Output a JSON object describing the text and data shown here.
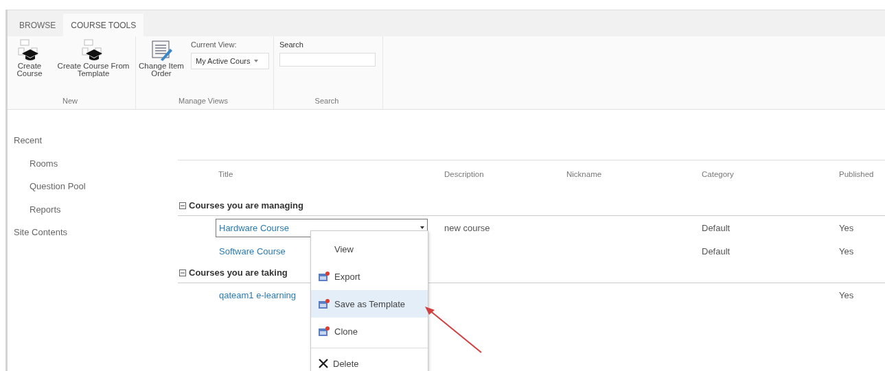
{
  "ribbon": {
    "tabs": [
      {
        "label": "BROWSE",
        "selected": false
      },
      {
        "label": "COURSE TOOLS",
        "selected": true
      }
    ],
    "groups": [
      {
        "name": "New",
        "buttons": [
          {
            "label": "Create Course",
            "kind": "course"
          },
          {
            "label": "Create Course From Template",
            "kind": "course"
          }
        ]
      },
      {
        "name": "Manage Views",
        "buttons": [
          {
            "label": "Change Item Order",
            "kind": "order"
          }
        ],
        "view_label": "Current View:",
        "view_value": "My Active Cours"
      },
      {
        "name": "Search",
        "search_label": "Search"
      }
    ]
  },
  "nav": [
    {
      "label": "Recent",
      "children": [
        {
          "label": "Rooms"
        },
        {
          "label": "Question Pool"
        },
        {
          "label": "Reports"
        }
      ]
    },
    {
      "label": "Site Contents"
    }
  ],
  "table": {
    "columns": [
      "Title",
      "Description",
      "Nickname",
      "Category",
      "Published"
    ],
    "groups": [
      {
        "title": "Courses you are managing",
        "expanded": true,
        "rows": [
          {
            "title": "Hardware Course",
            "description": "new course",
            "category": "Default",
            "published": "Yes",
            "focused": true
          },
          {
            "title": "Software Course",
            "category": "Default",
            "published": "Yes",
            "focused": false
          }
        ]
      },
      {
        "title": "Courses you are taking",
        "expanded": true,
        "rows": [
          {
            "title": "qateam1 e-learning",
            "published": "Yes",
            "focused": false
          }
        ]
      }
    ]
  },
  "context_menu": [
    {
      "label": "View",
      "kind": "plain",
      "selected": false
    },
    {
      "label": "Export",
      "kind": "icon",
      "selected": false
    },
    {
      "label": "Save as Template",
      "kind": "icon",
      "selected": true
    },
    {
      "label": "Clone",
      "kind": "icon",
      "selected": false
    },
    {
      "label": "Delete",
      "kind": "delete",
      "selected": false
    }
  ]
}
